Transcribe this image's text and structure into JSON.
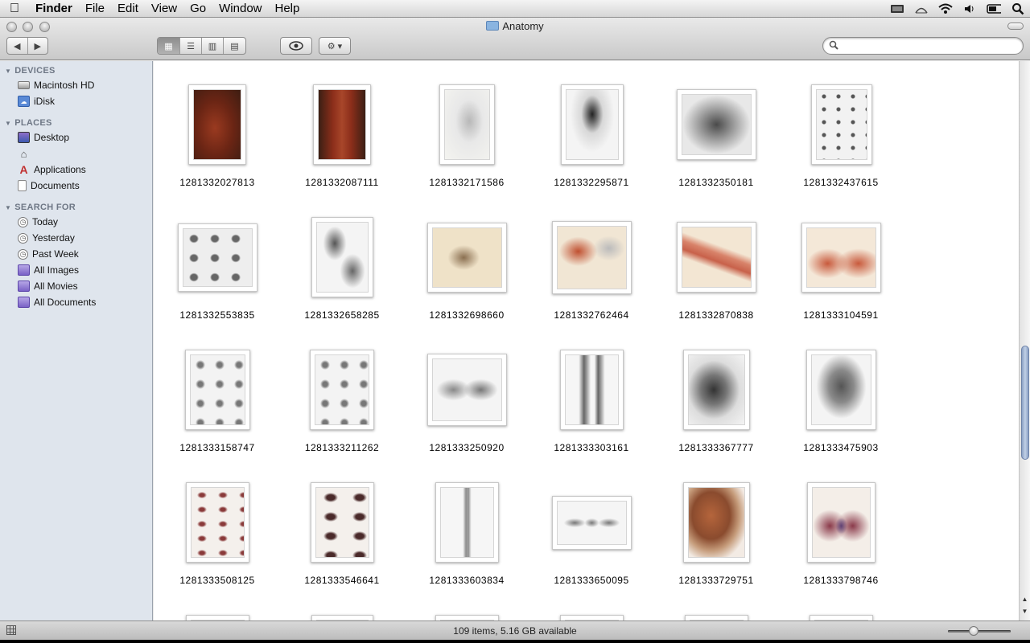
{
  "menubar": {
    "apple": "",
    "app": "Finder",
    "items": [
      "File",
      "Edit",
      "View",
      "Go",
      "Window",
      "Help"
    ],
    "status_icons": [
      "display-icon",
      "time-machine-icon",
      "wifi-icon",
      "volume-icon",
      "battery-icon",
      "spotlight-icon"
    ]
  },
  "window": {
    "title": "Anatomy",
    "nav": {
      "back": "◀",
      "forward": "▶"
    },
    "view_modes": [
      {
        "name": "icon-view",
        "glyph": "▦",
        "active": true
      },
      {
        "name": "list-view",
        "glyph": "☰",
        "active": false
      },
      {
        "name": "column-view",
        "glyph": "▥",
        "active": false
      },
      {
        "name": "coverflow-view",
        "glyph": "▤",
        "active": false
      }
    ],
    "quicklook": "👁",
    "action": "⚙ ▾",
    "search": {
      "value": "",
      "placeholder": ""
    }
  },
  "sidebar": {
    "sections": [
      {
        "title": "DEVICES",
        "items": [
          {
            "label": "Macintosh HD",
            "icon": "hard-drive-icon"
          },
          {
            "label": "iDisk",
            "icon": "idisk-icon"
          }
        ]
      },
      {
        "title": "PLACES",
        "items": [
          {
            "label": "Desktop",
            "icon": "desktop-icon"
          },
          {
            "label": "",
            "icon": "home-icon"
          },
          {
            "label": "Applications",
            "icon": "applications-icon"
          },
          {
            "label": "Documents",
            "icon": "documents-icon"
          }
        ]
      },
      {
        "title": "SEARCH FOR",
        "items": [
          {
            "label": "Today",
            "icon": "clock-icon"
          },
          {
            "label": "Yesterday",
            "icon": "clock-icon"
          },
          {
            "label": "Past Week",
            "icon": "clock-icon"
          },
          {
            "label": "All Images",
            "icon": "smart-folder-icon"
          },
          {
            "label": "All Movies",
            "icon": "smart-folder-icon"
          },
          {
            "label": "All Documents",
            "icon": "smart-folder-icon"
          }
        ]
      }
    ]
  },
  "files": [
    "1281332027813",
    "1281332087111",
    "1281332171586",
    "1281332295871",
    "1281332350181",
    "1281332437615",
    "1281332553835",
    "1281332658285",
    "1281332698660",
    "1281332762464",
    "1281332870838",
    "1281333104591",
    "1281333158747",
    "1281333211262",
    "1281333250920",
    "1281333303161",
    "1281333367777",
    "1281333475903",
    "1281333508125",
    "1281333546641",
    "1281333603834",
    "1281333650095",
    "1281333729751",
    "1281333798746"
  ],
  "statusbar": {
    "text": "109 items, 5.16 GB available",
    "icon_size_level": 0.4
  }
}
